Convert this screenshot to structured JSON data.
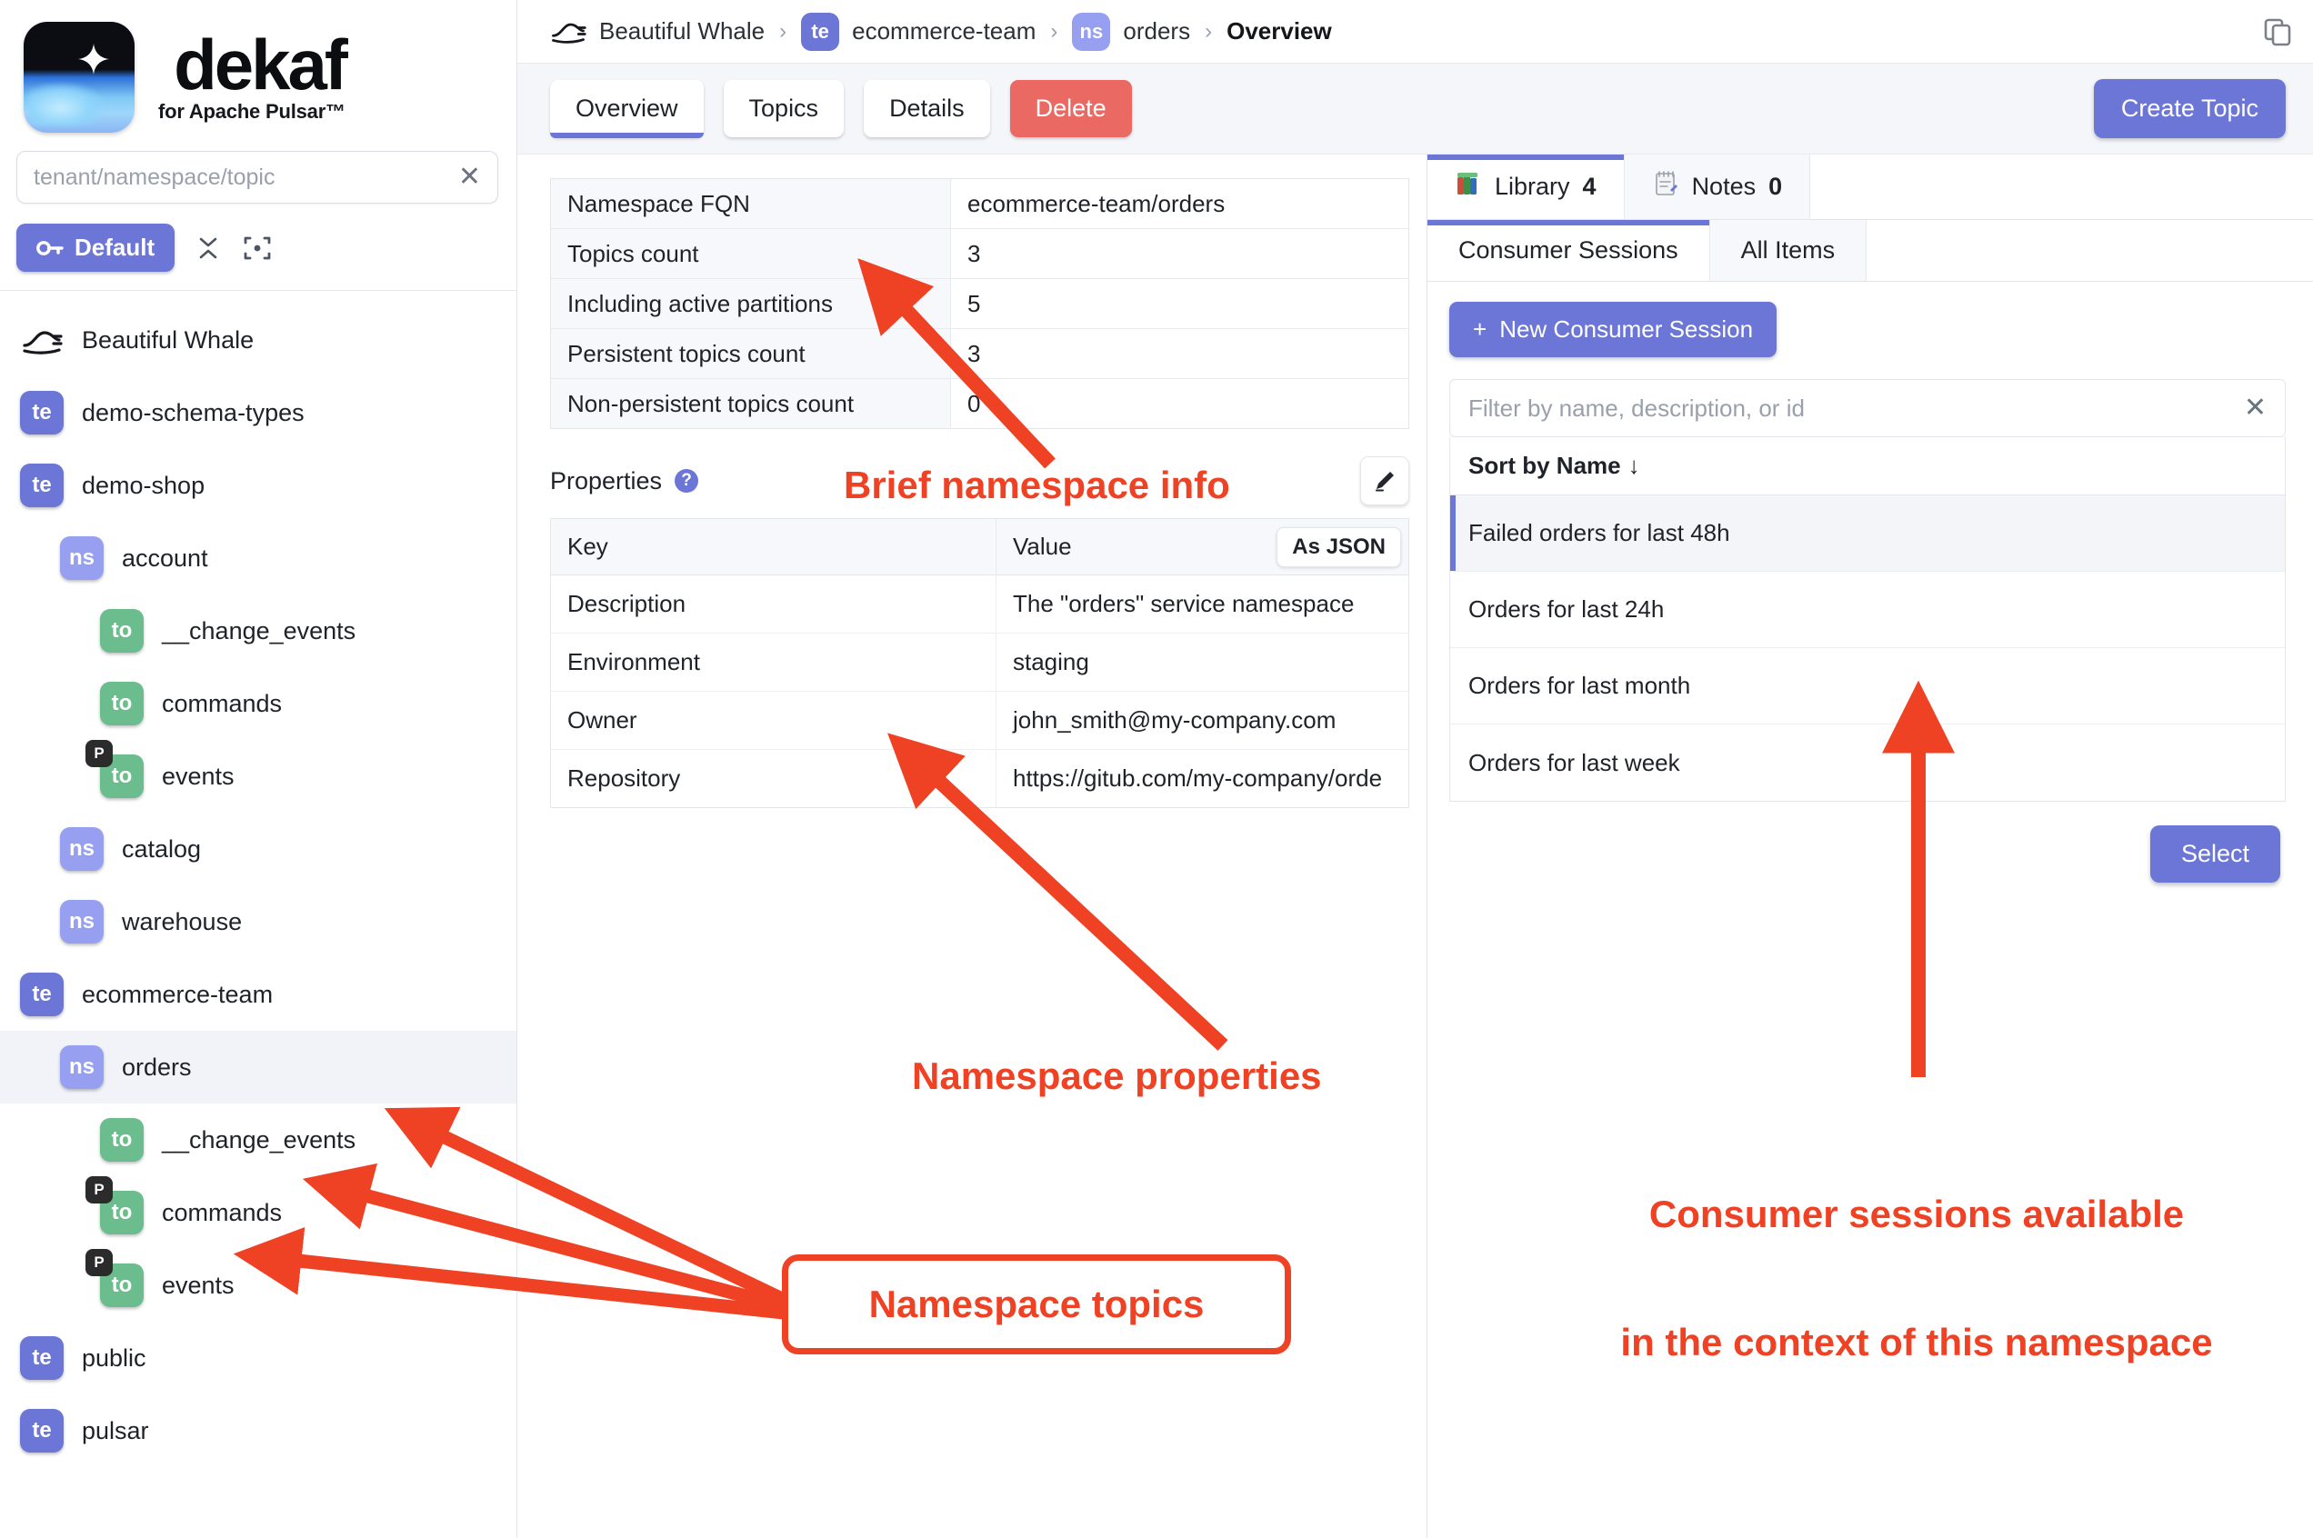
{
  "brand": {
    "name": "dekaf",
    "subtitle": "for Apache Pulsar™",
    "logo_icon": "dekaf-logo"
  },
  "sidebar": {
    "search": {
      "placeholder": "tenant/namespace/topic",
      "value": ""
    },
    "actions": {
      "default_label": "Default",
      "key_icon": "key-icon",
      "collapse_icon": "collapse-all-icon",
      "locate_icon": "locate-icon"
    },
    "tree": [
      {
        "label": "Beautiful Whale",
        "kind": "cluster",
        "badge": "",
        "level": 0,
        "selected": false,
        "partitioned": false
      },
      {
        "label": "demo-schema-types",
        "kind": "tenant",
        "badge": "te",
        "level": 1,
        "selected": false,
        "partitioned": false
      },
      {
        "label": "demo-shop",
        "kind": "tenant",
        "badge": "te",
        "level": 1,
        "selected": false,
        "partitioned": false
      },
      {
        "label": "account",
        "kind": "namespace",
        "badge": "ns",
        "level": 2,
        "selected": false,
        "partitioned": false
      },
      {
        "label": "__change_events",
        "kind": "topic",
        "badge": "to",
        "level": 3,
        "selected": false,
        "partitioned": false
      },
      {
        "label": "commands",
        "kind": "topic",
        "badge": "to",
        "level": 3,
        "selected": false,
        "partitioned": false
      },
      {
        "label": "events",
        "kind": "topic",
        "badge": "to",
        "level": 3,
        "selected": false,
        "partitioned": true
      },
      {
        "label": "catalog",
        "kind": "namespace",
        "badge": "ns",
        "level": 2,
        "selected": false,
        "partitioned": false
      },
      {
        "label": "warehouse",
        "kind": "namespace",
        "badge": "ns",
        "level": 2,
        "selected": false,
        "partitioned": false
      },
      {
        "label": "ecommerce-team",
        "kind": "tenant",
        "badge": "te",
        "level": 1,
        "selected": false,
        "partitioned": false
      },
      {
        "label": "orders",
        "kind": "namespace",
        "badge": "ns",
        "level": 2,
        "selected": true,
        "partitioned": false
      },
      {
        "label": "__change_events",
        "kind": "topic",
        "badge": "to",
        "level": 3,
        "selected": false,
        "partitioned": false
      },
      {
        "label": "commands",
        "kind": "topic",
        "badge": "to",
        "level": 3,
        "selected": false,
        "partitioned": true
      },
      {
        "label": "events",
        "kind": "topic",
        "badge": "to",
        "level": 3,
        "selected": false,
        "partitioned": true
      },
      {
        "label": "public",
        "kind": "tenant",
        "badge": "te",
        "level": 1,
        "selected": false,
        "partitioned": false
      },
      {
        "label": "pulsar",
        "kind": "tenant",
        "badge": "te",
        "level": 1,
        "selected": false,
        "partitioned": false
      }
    ],
    "partition_flag": "P"
  },
  "topbar": {
    "breadcrumb": [
      {
        "label": "Beautiful Whale",
        "badge": "",
        "current": false
      },
      {
        "label": "ecommerce-team",
        "badge": "te",
        "current": false
      },
      {
        "label": "orders",
        "badge": "ns",
        "current": false
      },
      {
        "label": "Overview",
        "badge": "",
        "current": true
      }
    ],
    "separator": "›",
    "copy_icon": "copy-icon"
  },
  "toolbar": {
    "tabs": [
      {
        "label": "Overview",
        "active": true,
        "danger": false
      },
      {
        "label": "Topics",
        "active": false,
        "danger": false
      },
      {
        "label": "Details",
        "active": false,
        "danger": false
      },
      {
        "label": "Delete",
        "active": false,
        "danger": true
      }
    ],
    "create_topic_label": "Create Topic"
  },
  "overview": {
    "info_rows": [
      {
        "key": "Namespace FQN",
        "value": "ecommerce-team/orders"
      },
      {
        "key": "Topics count",
        "value": "3"
      },
      {
        "key": "Including active partitions",
        "value": "5"
      },
      {
        "key": "Persistent topics count",
        "value": "3"
      },
      {
        "key": "Non-persistent topics count",
        "value": "0"
      }
    ],
    "properties": {
      "title": "Properties",
      "help_icon": "help-icon",
      "edit_icon": "pencil-icon",
      "as_json_label": "As JSON",
      "columns": [
        "Key",
        "Value"
      ],
      "rows": [
        {
          "key": "Description",
          "value": "The \"orders\" service namespace"
        },
        {
          "key": "Environment",
          "value": "staging"
        },
        {
          "key": "Owner",
          "value": "john_smith@my-company.com"
        },
        {
          "key": "Repository",
          "value": "https://gitub.com/my-company/orde"
        }
      ]
    }
  },
  "right_panel": {
    "tabs": [
      {
        "label": "Library",
        "count": "4",
        "icon": "books-icon",
        "active": true
      },
      {
        "label": "Notes",
        "count": "0",
        "icon": "notepad-icon",
        "active": false
      }
    ],
    "subtabs": [
      {
        "label": "Consumer Sessions",
        "active": true
      },
      {
        "label": "All Items",
        "active": false
      }
    ],
    "new_session_label": "New Consumer Session",
    "new_session_icon": "plus-icon",
    "filter": {
      "placeholder": "Filter by name, description, or id",
      "value": "",
      "clear_icon": "close-icon"
    },
    "sort_label": "Sort by Name",
    "sort_icon": "arrow-down-icon",
    "items": [
      {
        "label": "Failed orders for last 48h",
        "selected": true
      },
      {
        "label": "Orders for last 24h",
        "selected": false
      },
      {
        "label": "Orders for last month",
        "selected": false
      },
      {
        "label": "Orders for last week",
        "selected": false
      }
    ],
    "select_label": "Select"
  },
  "annotations": {
    "color": "#ef4123",
    "brief_info": "Brief namespace info",
    "namespace_properties": "Namespace properties",
    "namespace_topics": "Namespace topics",
    "consumer_sessions_line1": "Consumer sessions available",
    "consumer_sessions_line2": "in the context of this namespace"
  }
}
